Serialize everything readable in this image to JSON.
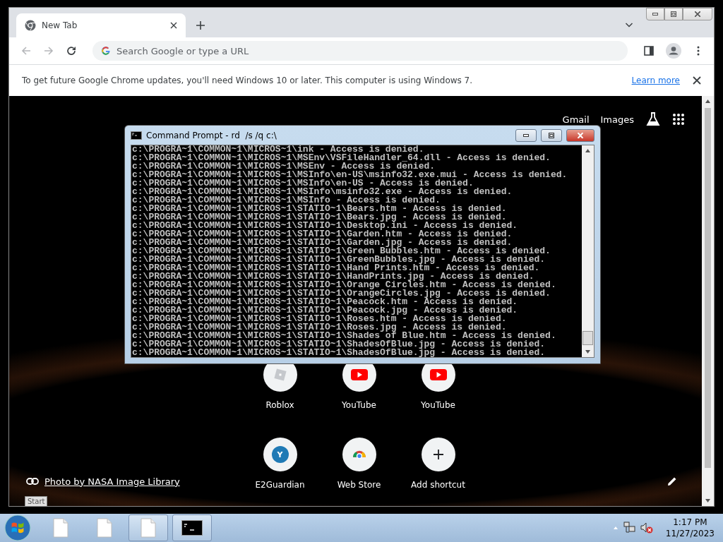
{
  "browser": {
    "tabs": [
      {
        "title": "New Tab",
        "selected": true
      }
    ],
    "omnibox": {
      "placeholder": "Search Google or type a URL"
    },
    "infobar": {
      "message": "To get future Google Chrome updates, you'll need Windows 10 or later. This computer is using Windows 7.",
      "link": "Learn more"
    }
  },
  "new_tab_page": {
    "header_links": [
      "Gmail",
      "Images"
    ],
    "shortcuts": [
      {
        "label": "Roblox",
        "kind": "roblox"
      },
      {
        "label": "YouTube",
        "kind": "youtube"
      },
      {
        "label": "YouTube",
        "kind": "youtube"
      },
      {
        "label": "E2Guardian",
        "kind": "letter",
        "badge": "Y"
      },
      {
        "label": "Web Store",
        "kind": "webstore"
      },
      {
        "label": "Add shortcut",
        "kind": "add"
      }
    ],
    "photo_credit": "Photo by NASA Image Library"
  },
  "console": {
    "title": "Command Prompt - rd  /s /q c:\\",
    "lines": [
      "c:\\PROGRA~1\\COMMON~1\\MICROS~1\\ink - Access is denied.",
      "c:\\PROGRA~1\\COMMON~1\\MICROS~1\\MSEnv\\VSFileHandler_64.dll - Access is denied.",
      "c:\\PROGRA~1\\COMMON~1\\MICROS~1\\MSEnv - Access is denied.",
      "c:\\PROGRA~1\\COMMON~1\\MICROS~1\\MSInfo\\en-US\\msinfo32.exe.mui - Access is denied.",
      "c:\\PROGRA~1\\COMMON~1\\MICROS~1\\MSInfo\\en-US - Access is denied.",
      "c:\\PROGRA~1\\COMMON~1\\MICROS~1\\MSInfo\\msinfo32.exe - Access is denied.",
      "c:\\PROGRA~1\\COMMON~1\\MICROS~1\\MSInfo - Access is denied.",
      "c:\\PROGRA~1\\COMMON~1\\MICROS~1\\STATIO~1\\Bears.htm - Access is denied.",
      "c:\\PROGRA~1\\COMMON~1\\MICROS~1\\STATIO~1\\Bears.jpg - Access is denied.",
      "c:\\PROGRA~1\\COMMON~1\\MICROS~1\\STATIO~1\\Desktop.ini - Access is denied.",
      "c:\\PROGRA~1\\COMMON~1\\MICROS~1\\STATIO~1\\Garden.htm - Access is denied.",
      "c:\\PROGRA~1\\COMMON~1\\MICROS~1\\STATIO~1\\Garden.jpg - Access is denied.",
      "c:\\PROGRA~1\\COMMON~1\\MICROS~1\\STATIO~1\\Green Bubbles.htm - Access is denied.",
      "c:\\PROGRA~1\\COMMON~1\\MICROS~1\\STATIO~1\\GreenBubbles.jpg - Access is denied.",
      "c:\\PROGRA~1\\COMMON~1\\MICROS~1\\STATIO~1\\Hand Prints.htm - Access is denied.",
      "c:\\PROGRA~1\\COMMON~1\\MICROS~1\\STATIO~1\\HandPrints.jpg - Access is denied.",
      "c:\\PROGRA~1\\COMMON~1\\MICROS~1\\STATIO~1\\Orange Circles.htm - Access is denied.",
      "c:\\PROGRA~1\\COMMON~1\\MICROS~1\\STATIO~1\\OrangeCircles.jpg - Access is denied.",
      "c:\\PROGRA~1\\COMMON~1\\MICROS~1\\STATIO~1\\Peacock.htm - Access is denied.",
      "c:\\PROGRA~1\\COMMON~1\\MICROS~1\\STATIO~1\\Peacock.jpg - Access is denied.",
      "c:\\PROGRA~1\\COMMON~1\\MICROS~1\\STATIO~1\\Roses.htm - Access is denied.",
      "c:\\PROGRA~1\\COMMON~1\\MICROS~1\\STATIO~1\\Roses.jpg - Access is denied.",
      "c:\\PROGRA~1\\COMMON~1\\MICROS~1\\STATIO~1\\Shades of Blue.htm - Access is denied.",
      "c:\\PROGRA~1\\COMMON~1\\MICROS~1\\STATIO~1\\ShadesOfBlue.jpg - Access is denied.",
      "c:\\PROGRA~1\\COMMON~1\\MICROS~1\\STATIO~1\\ShadesOfBlue.jpg - Access is denied."
    ]
  },
  "tooltip": "Start",
  "taskbar": {
    "items": [
      {
        "kind": "file",
        "running": false
      },
      {
        "kind": "file",
        "running": false
      },
      {
        "kind": "file",
        "running": true
      },
      {
        "kind": "console",
        "running": true
      }
    ],
    "time": "1:17 PM",
    "date": "11/27/2023"
  }
}
